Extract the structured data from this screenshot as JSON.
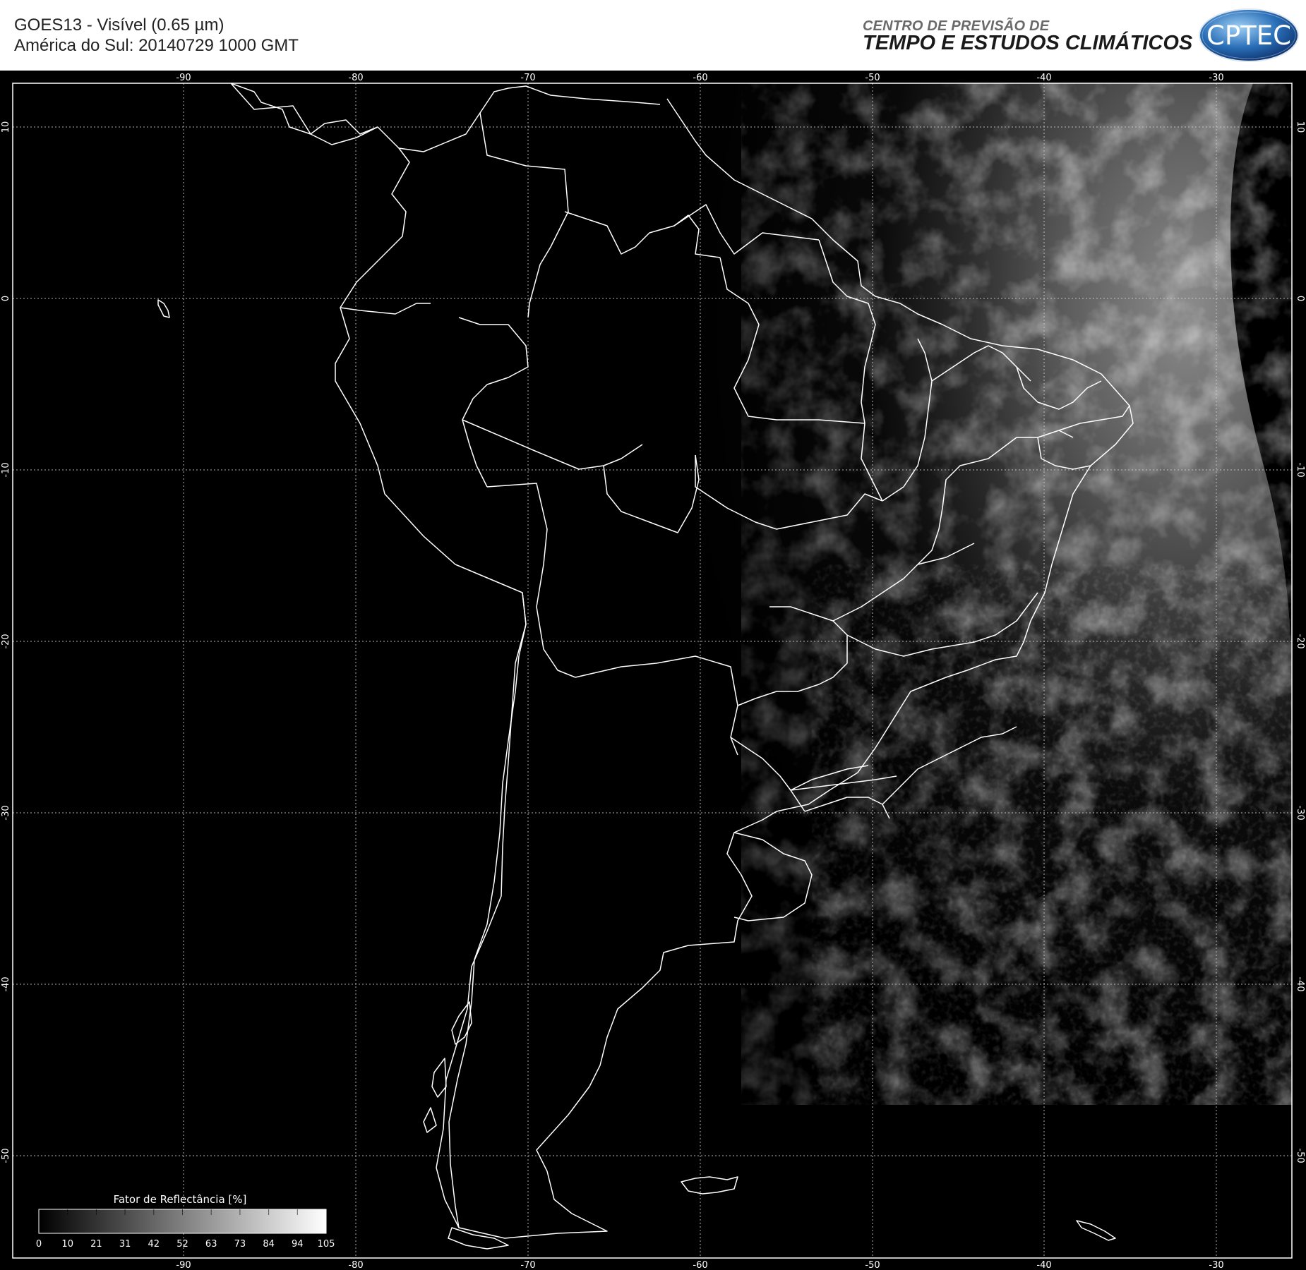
{
  "header": {
    "title_line1": "GOES13 - Visível (0.65 µm)",
    "title_line2": "América do Sul: 20140729 1000 GMT",
    "org_line1": "CENTRO DE PREVISÃO DE",
    "org_line2": "TEMPO E ESTUDOS CLIMÁTICOS",
    "logo_text": "CPTEC"
  },
  "map": {
    "lon_labels": [
      "-90",
      "-80",
      "-70",
      "-60",
      "-50",
      "-40",
      "-30"
    ],
    "lat_labels": [
      "10",
      "0",
      "-10",
      "-20",
      "-30",
      "-40",
      "-50"
    ],
    "colorbar": {
      "title": "Fator de Reflectância [%]",
      "ticks": [
        "0",
        "10",
        "21",
        "31",
        "42",
        "52",
        "63",
        "73",
        "84",
        "94",
        "105"
      ]
    }
  }
}
